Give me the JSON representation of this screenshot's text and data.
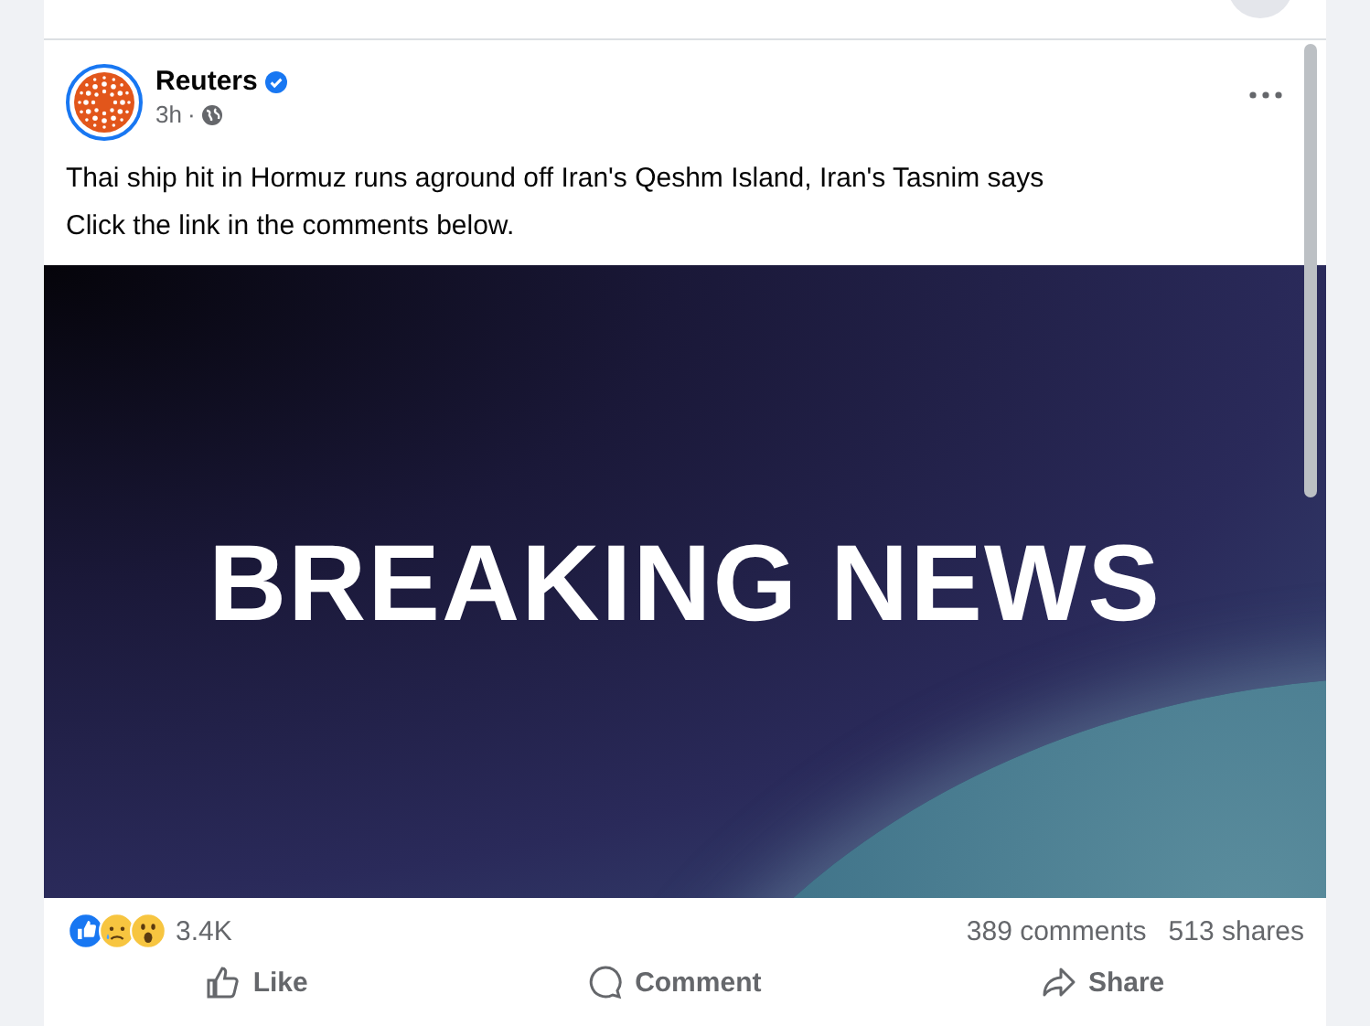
{
  "post": {
    "author": "Reuters",
    "verified": true,
    "time": "3h",
    "separator": "·",
    "text": "Thai ship hit in Hormuz runs aground off Iran's Qeshm Island, Iran's Tasnim says",
    "subtext": "Click the link in the comments below.",
    "image": {
      "headline": "BREAKING NEWS"
    },
    "reaction_count": "3.4K",
    "comments": "389 comments",
    "shares": "513 shares",
    "actions": [
      {
        "kind": "like",
        "label": "Like"
      },
      {
        "kind": "comment",
        "label": "Comment"
      },
      {
        "kind": "share",
        "label": "Share"
      }
    ]
  }
}
